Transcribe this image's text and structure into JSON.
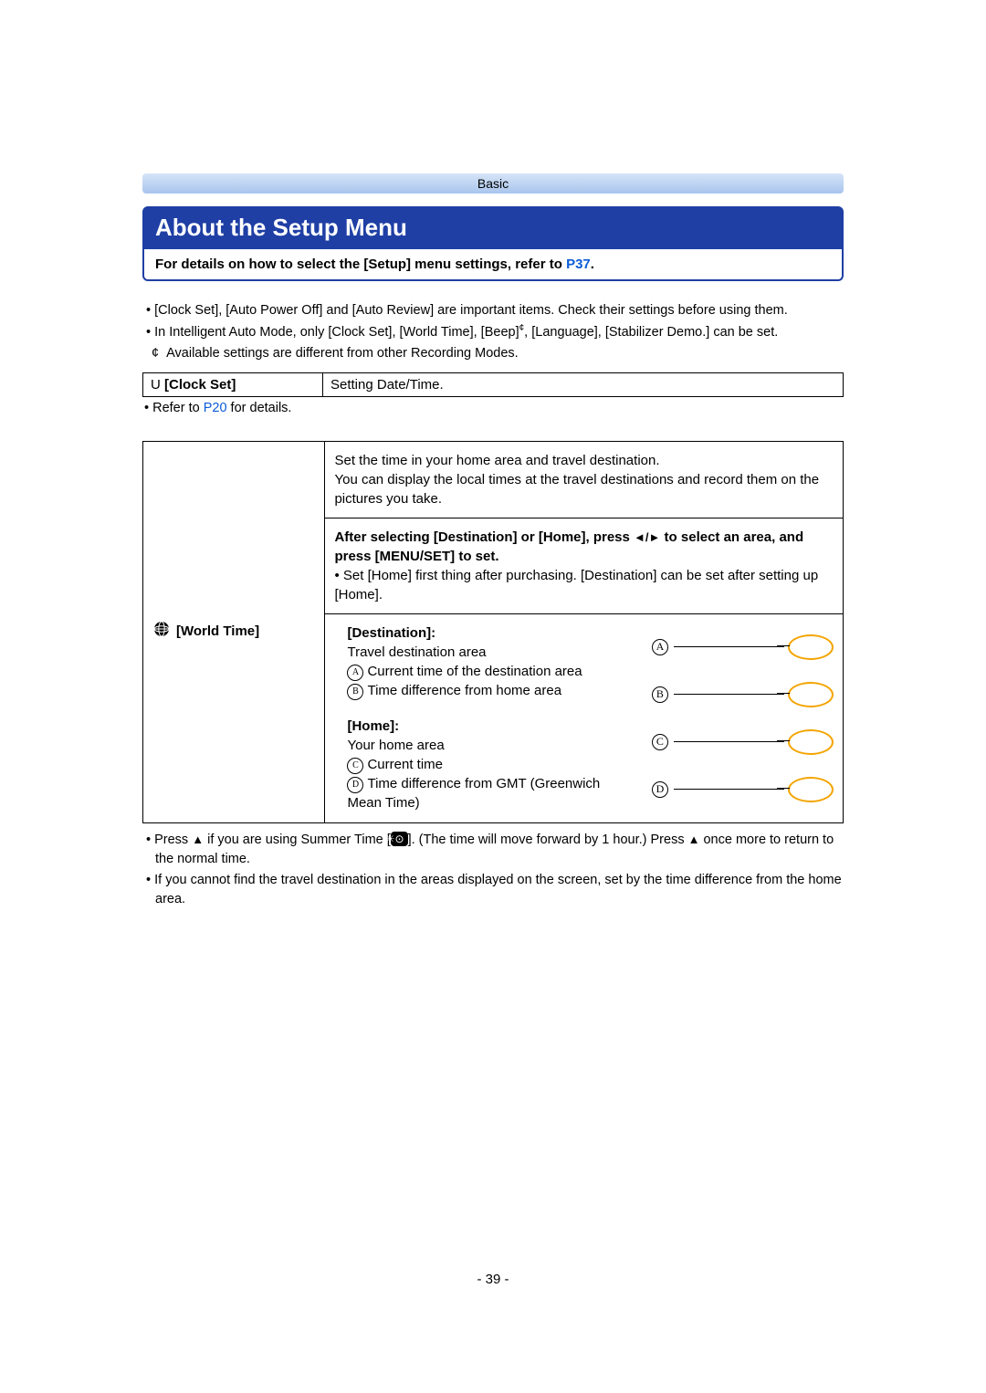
{
  "header": {
    "section": "Basic"
  },
  "title": "About the Setup Menu",
  "infobox": {
    "prefix": "For details on how to select the [Setup] menu settings, refer to ",
    "link": "P37",
    "suffix": "."
  },
  "intro": {
    "b1": "[Clock Set], [Auto Power Off] and [Auto Review] are important items. Check their settings before using them.",
    "b2_pre": "In Intelligent Auto Mode, only [Clock Set], [World Time], [Beep]",
    "b2_post": ", [Language], [Stabilizer Demo.] can be set.",
    "sub_marker": "¢",
    "sub": "Available settings are different from other Recording Modes."
  },
  "clock": {
    "icon": "U",
    "label": "[Clock Set]",
    "desc": "Setting Date/Time.",
    "note_pre": "Refer to ",
    "note_link": "P20",
    "note_post": " for details."
  },
  "world": {
    "label": "[World Time]",
    "row1": "Set the time in your home area and travel destination.\nYou can display the local times at the travel destinations and record them on the pictures you take.",
    "row2_bold_pre": "After selecting [Destination] or [Home], press ",
    "row2_bold_arrows": "◄/►",
    "row2_bold_post": " to select an area, and press [MENU/SET] to set.",
    "row2_note": "Set [Home] first thing after purchasing. [Destination] can be set after setting up [Home].",
    "dest_h": "[Destination]:",
    "dest_sub": "Travel destination area",
    "dest_a": "Current time of the destination area",
    "dest_b": "Time difference from home area",
    "home_h": "[Home]:",
    "home_sub": "Your home area",
    "home_c": "Current time",
    "home_d": "Time difference from GMT (Greenwich Mean Time)",
    "circ_a": "A",
    "circ_b": "B",
    "circ_c": "C",
    "circ_d": "D"
  },
  "footer": {
    "f1_pre": "Press ",
    "up": "▲",
    "f1_mid1": " if you are using Summer Time [",
    "sun": "☀⊙",
    "f1_mid2": "]. (The time will move forward by 1 hour.) Press ",
    "f1_post": " once more to return to the normal time.",
    "f2": "If you cannot find the travel destination in the areas displayed on the screen, set by the time difference from the home area."
  },
  "pagenum": "- 39 -"
}
